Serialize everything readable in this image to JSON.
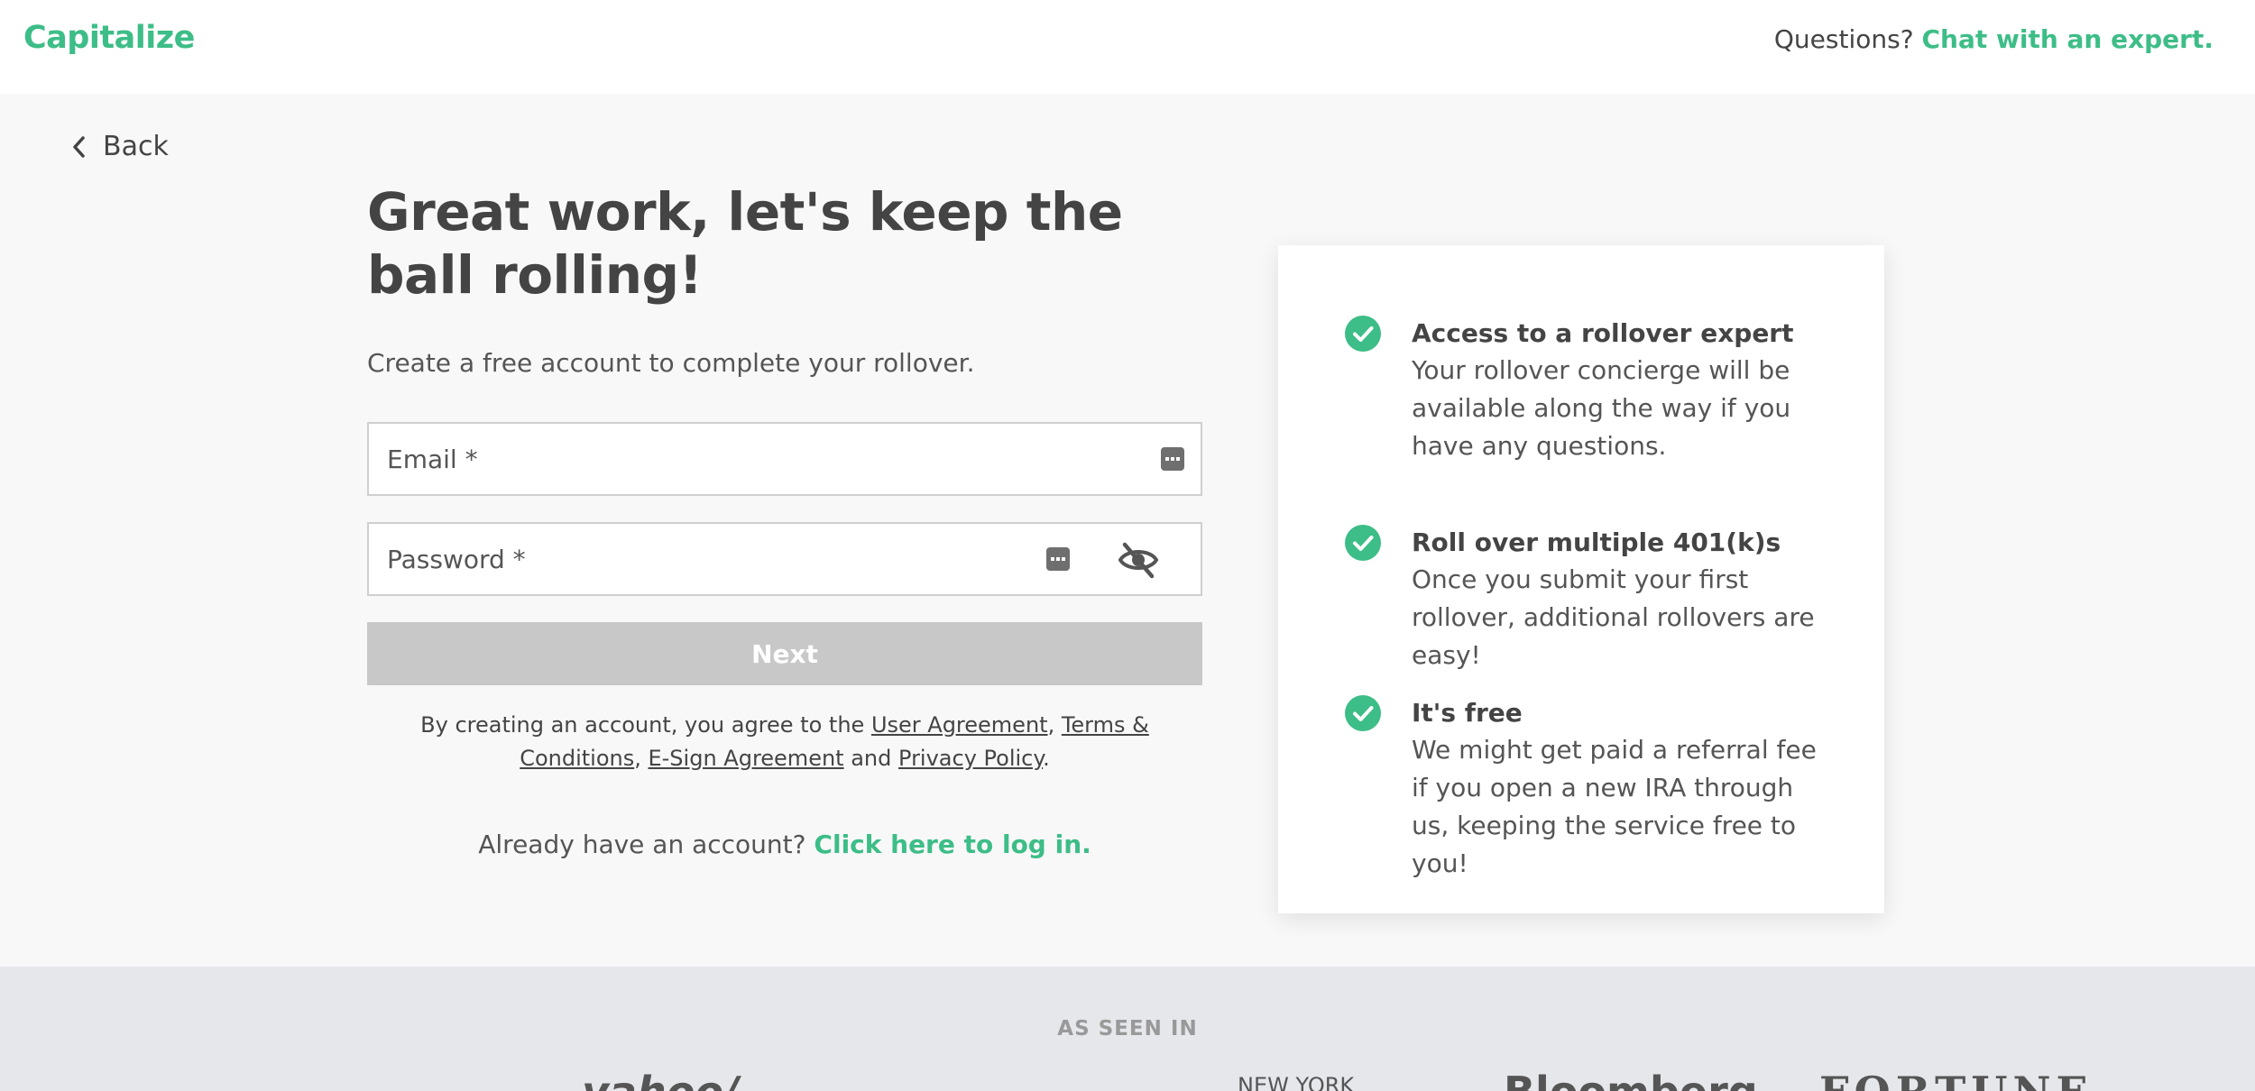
{
  "header": {
    "logo": "Capitalize",
    "questions": "Questions?",
    "chat_link": "Chat with an expert."
  },
  "nav": {
    "back_label": "Back"
  },
  "main": {
    "heading": "Great work, let's keep the ball rolling!",
    "subheading": "Create a free account to complete your rollover.",
    "email_placeholder": "Email *",
    "password_placeholder": "Password *",
    "next_label": "Next",
    "legal": {
      "prefix": "By creating an account, you agree to the",
      "user_agreement": "User Agreement",
      "terms": "Terms & Conditions",
      "esign": "E-Sign Agreement",
      "and": "and",
      "privacy": "Privacy Policy"
    },
    "login_prompt": "Already have an account?",
    "login_link": "Click here to log in."
  },
  "benefits": [
    {
      "title": "Access to a rollover expert",
      "desc": "Your rollover concierge will be available along the way if you have any questions."
    },
    {
      "title": "Roll over multiple 401(k)s",
      "desc": "Once you submit your first rollover, additional rollovers are easy!"
    },
    {
      "title": "It's free",
      "desc": "We might get paid a referral fee if you open a new IRA through us, keeping the service free to you!"
    }
  ],
  "footer": {
    "as_seen_in": "AS SEEN IN",
    "publications": [
      "yahoo/",
      "NEW YORK",
      "Bloomberg",
      "FORTUNE"
    ]
  },
  "colors": {
    "accent": "#3dbd87",
    "button_disabled": "#c8c8c8"
  }
}
